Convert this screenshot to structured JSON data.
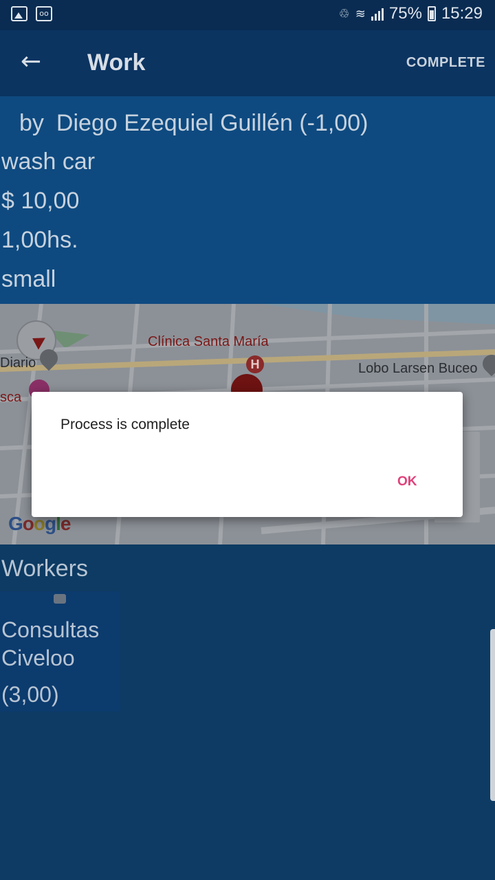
{
  "status_bar": {
    "left_icons": [
      "image-notification-icon",
      "voicemail-icon"
    ],
    "battery_percent": "75%",
    "time": "15:29"
  },
  "app_bar": {
    "back_icon": "arrow-left-icon",
    "title": "Work",
    "action_label": "COMPLETE"
  },
  "work": {
    "by_label": "by",
    "author": "Diego Ezequiel Guillén (-1,00)",
    "description": "wash car",
    "price": "$ 10,00",
    "duration": "1,00hs.",
    "size": "small"
  },
  "map": {
    "labels": {
      "clinic": "Clínica Santa María",
      "diario": "Diario",
      "sca": "sca",
      "lobo": "Lobo Larsen Buceo"
    },
    "logo": "Google"
  },
  "workers": {
    "title": "Workers",
    "items": [
      {
        "name": "Consultas Civeloo",
        "rating": "(3,00)"
      }
    ]
  },
  "dialog": {
    "message": "Process is complete",
    "ok_label": "OK"
  },
  "colors": {
    "status_bar": "#0a2c52",
    "app_bar": "#0b3461",
    "details_bg": "#0e4a80",
    "page_bg": "#0d3b63",
    "accent": "#e0417a"
  }
}
